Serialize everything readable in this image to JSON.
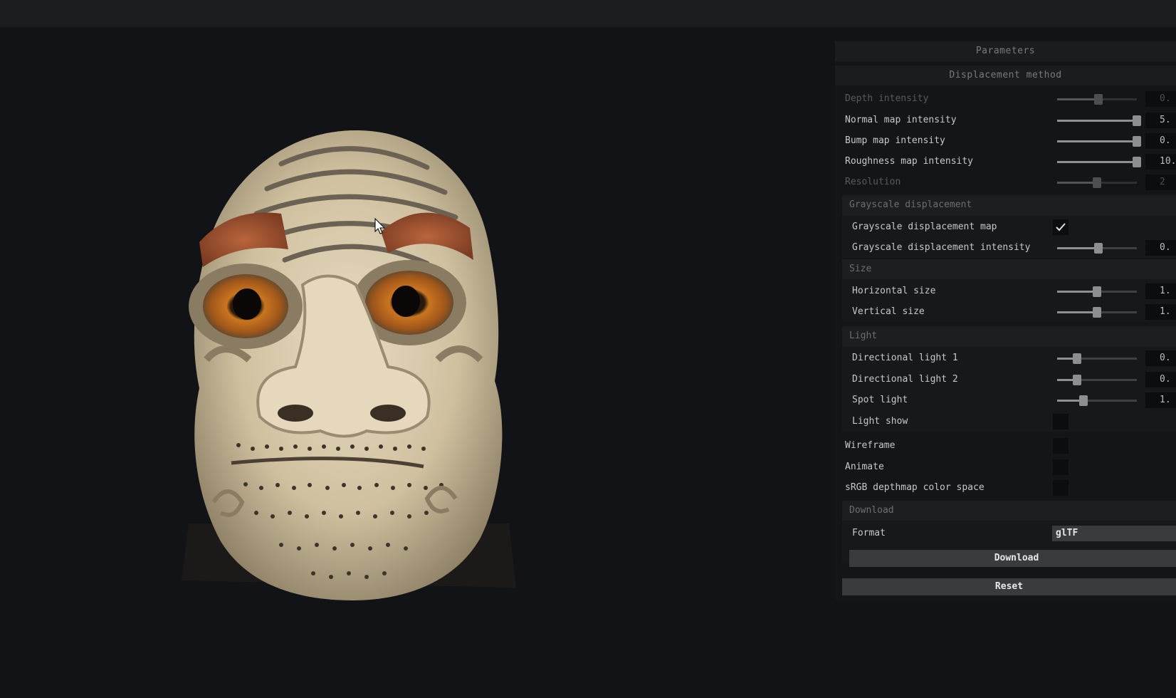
{
  "panel": {
    "title": "Parameters",
    "displacement_method": "Displacement method",
    "rows": {
      "depth_intensity": {
        "label": "Depth intensity",
        "value": "0.",
        "level": 0.52
      },
      "normal_map_intensity": {
        "label": "Normal map intensity",
        "value": "5.",
        "level": 1.0
      },
      "bump_map_intensity": {
        "label": "Bump map intensity",
        "value": "0.",
        "level": 1.0
      },
      "roughness_map_intensity": {
        "label": "Roughness map intensity",
        "value": "10.",
        "level": 1.0
      },
      "resolution": {
        "label": "Resolution",
        "value": "2",
        "level": 0.5
      }
    },
    "grayscale": {
      "header": "Grayscale displacement",
      "map_label": "Grayscale displacement map",
      "map_checked": true,
      "intensity": {
        "label": "Grayscale displacement intensity",
        "value": "0.",
        "level": 0.52
      }
    },
    "size": {
      "header": "Size",
      "horizontal": {
        "label": "Horizontal size",
        "value": "1.",
        "level": 0.5
      },
      "vertical": {
        "label": "Vertical size",
        "value": "1.",
        "level": 0.5
      }
    },
    "light": {
      "header": "Light",
      "directional1": {
        "label": "Directional light 1",
        "value": "0.",
        "level": 0.25
      },
      "directional2": {
        "label": "Directional light 2",
        "value": "0.",
        "level": 0.25
      },
      "spot": {
        "label": "Spot light",
        "value": "1.",
        "level": 0.33
      },
      "light_show": {
        "label": "Light show",
        "checked": false
      }
    },
    "wireframe": {
      "label": "Wireframe",
      "checked": false
    },
    "animate": {
      "label": "Animate",
      "checked": false
    },
    "srgb": {
      "label": "sRGB depthmap color space",
      "checked": false
    },
    "download": {
      "header": "Download",
      "format_label": "Format",
      "format_value": "glTF",
      "download_button": "Download"
    },
    "reset_button": "Reset"
  },
  "icons": {
    "cursor": "cursor-arrow-icon",
    "check": "checkmark-icon"
  },
  "colors": {
    "background": "#121316",
    "panel": "#141518",
    "control": "#3a3b3f"
  }
}
